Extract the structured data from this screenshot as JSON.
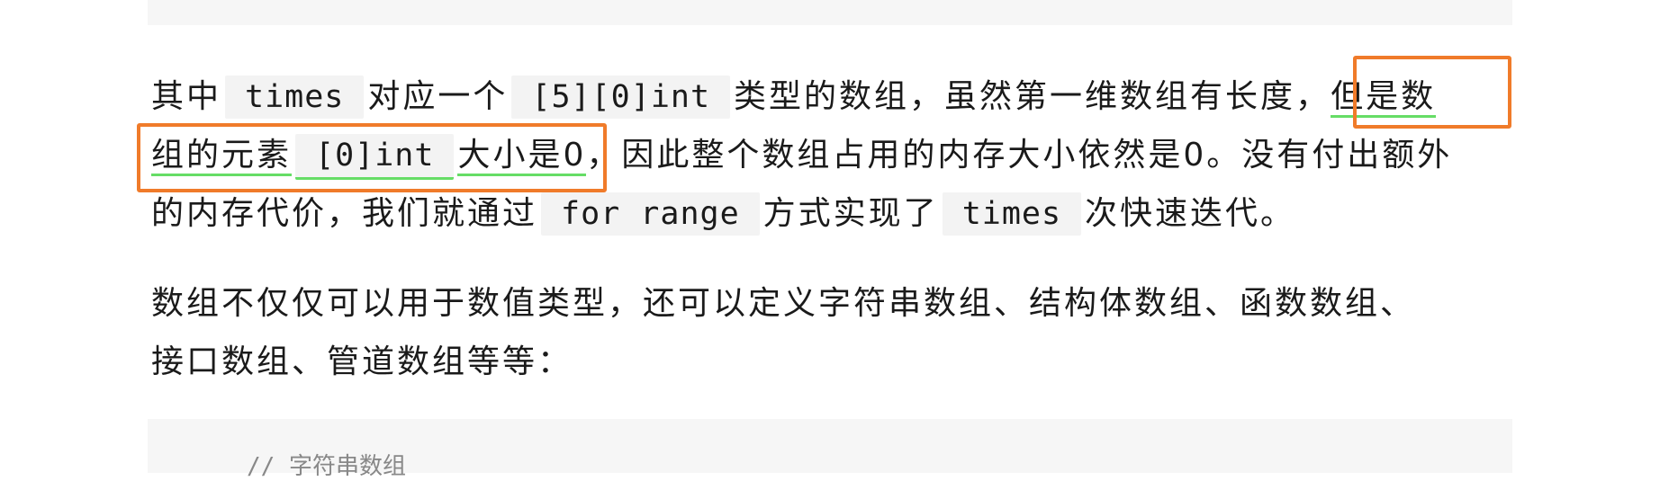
{
  "paragraph1": {
    "line1": {
      "t1": "其中",
      "c1": "times",
      "t2": "对应一个",
      "c2": "[5][0]int",
      "t3": "类型的数组，虽然第一维数组有长度，",
      "h1": "但是数"
    },
    "line2": {
      "h2": "组的元素",
      "c3": "[0]int",
      "h3": "大小是0",
      "t4": "，因此整个数组占用的内存大小依然是0。没有付出额外"
    },
    "line3": {
      "t5": "的内存代价，我们就通过",
      "c4": "for range",
      "t6": "方式实现了",
      "c5": "times",
      "t7": "次快速迭代。"
    }
  },
  "paragraph2": {
    "line1": "数组不仅仅可以用于数值类型，还可以定义字符串数组、结构体数组、函数数组、",
    "line2": "接口数组、管道数组等等："
  },
  "code_bottom": {
    "text": "// 字符串数组"
  },
  "colors": {
    "annotation_box": "#f07b2a",
    "highlight_underline": "#66dd66",
    "code_background": "#f3f3f3"
  }
}
